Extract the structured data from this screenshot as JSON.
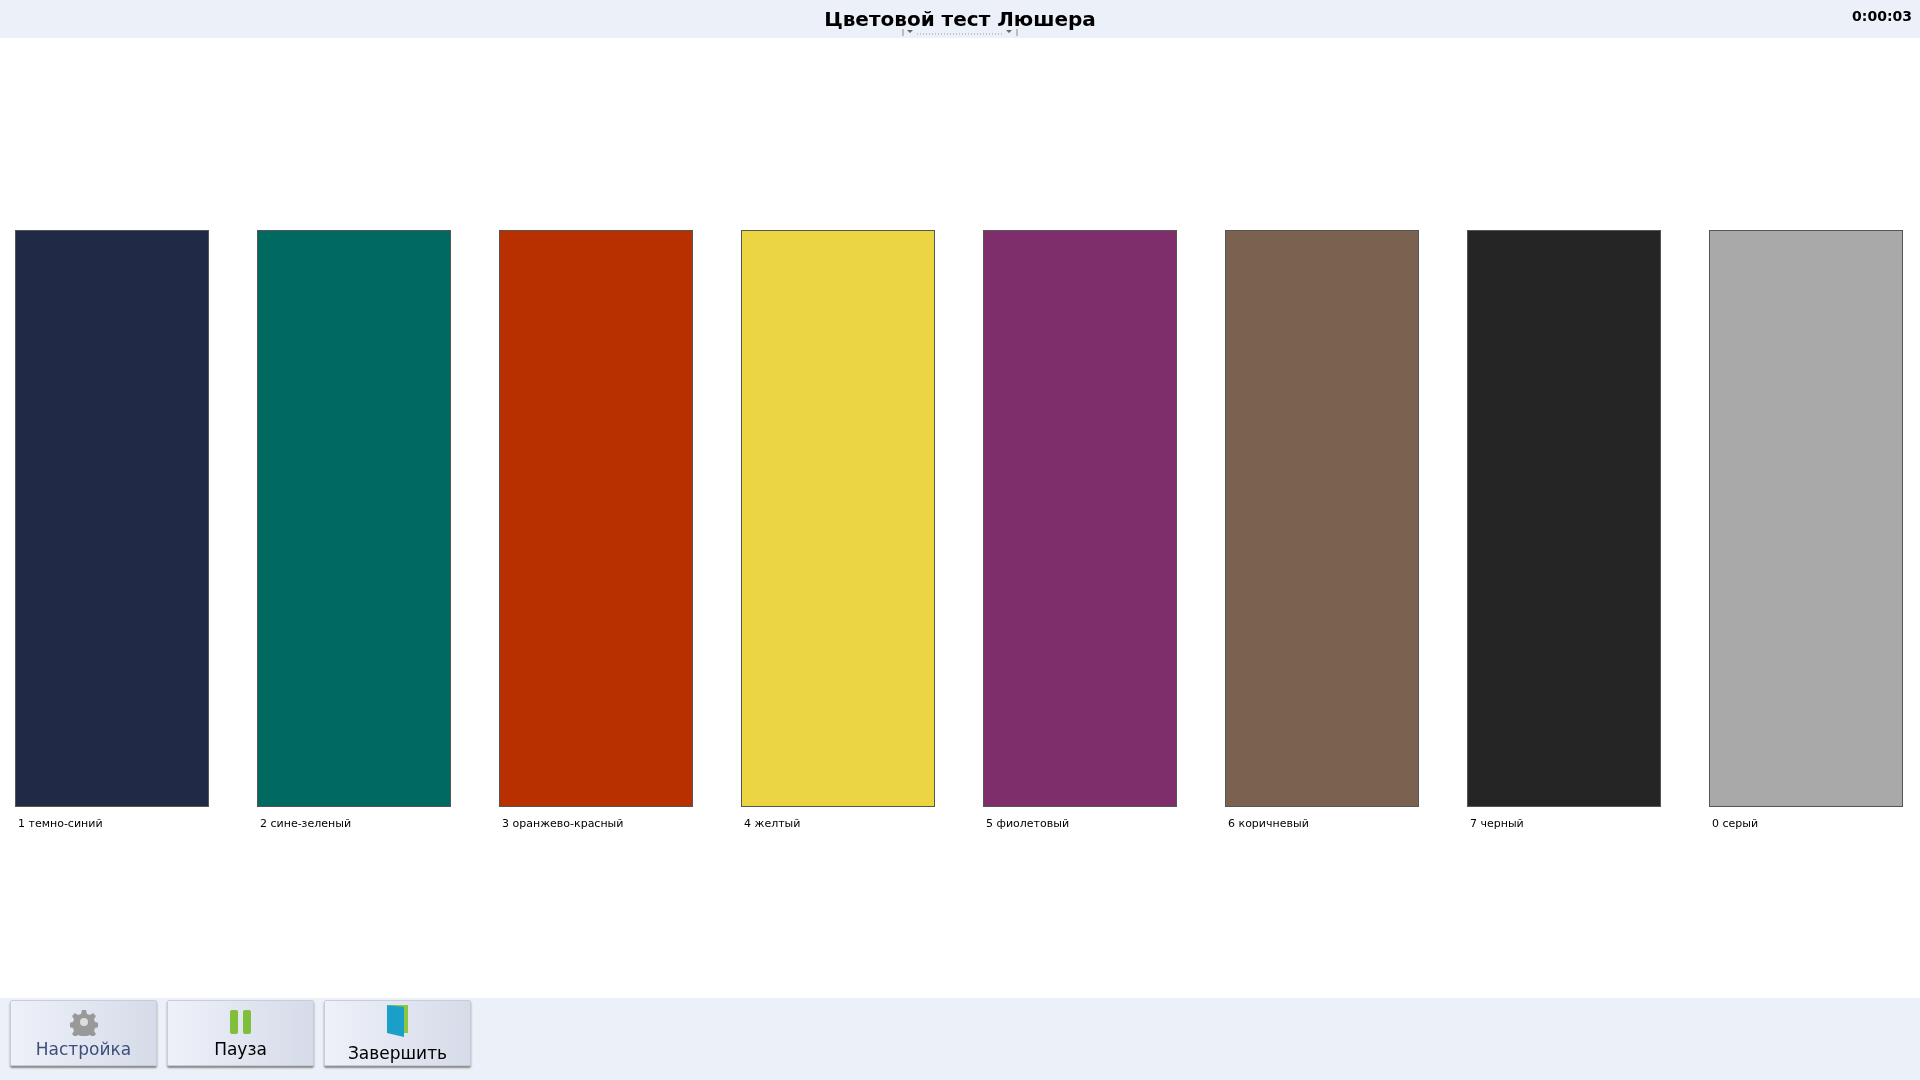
{
  "window": {
    "title": "Цветовой тест Люшера",
    "timer": "0:00:03"
  },
  "swatches": [
    {
      "label": "1 темно-синий",
      "color": "#202a47"
    },
    {
      "label": "2 сине-зеленый",
      "color": "#006a60"
    },
    {
      "label": "3 оранжево-красный",
      "color": "#b82f00"
    },
    {
      "label": "4 желтый",
      "color": "#ebd542"
    },
    {
      "label": "5 фиолетовый",
      "color": "#7e2f6b"
    },
    {
      "label": "6 коричневый",
      "color": "#7b6150"
    },
    {
      "label": "7 черный",
      "color": "#252525"
    },
    {
      "label": "0 серый",
      "color": "#a9a9a9"
    }
  ],
  "buttons": [
    {
      "label": "Настройка",
      "kind": "settings",
      "disabled": true
    },
    {
      "label": "Пауза",
      "kind": "pause",
      "disabled": false
    },
    {
      "label": "Завершить",
      "kind": "finish",
      "disabled": false
    }
  ]
}
